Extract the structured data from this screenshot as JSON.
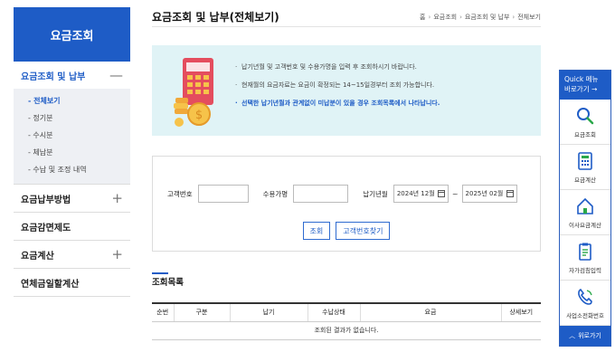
{
  "sidebar": {
    "header": "요금조회",
    "sections": [
      {
        "label": "요금조회 및 납부",
        "toggle": "—",
        "items": [
          "- 전체보기",
          "- 정기분",
          "- 수시분",
          "- 체납분",
          "- 수납 및 조정 내역"
        ]
      },
      {
        "label": "요금납부방법",
        "toggle": "+"
      },
      {
        "label": "요금감면제도",
        "toggle": ""
      },
      {
        "label": "요금계산",
        "toggle": "+"
      },
      {
        "label": "연체금일할계산",
        "toggle": ""
      }
    ]
  },
  "page": {
    "title": "요금조회 및 납부(전체보기)",
    "breadcrumb": [
      "홈",
      "요금조회",
      "요금조회 및 납부",
      "전체보기"
    ]
  },
  "info": {
    "lines": [
      "납기년월 및 고객번호 및 수용가명을 입력 후 조회하시기 바랍니다.",
      "현재월의 요금자료는 요금이 확정되는 14~15일경부터 조회 가능합니다.",
      "선택한 납기년월과 관계없이 미납분이 있을 경우 조회목록에서 나타납니다."
    ]
  },
  "search": {
    "customer_no_label": "고객번호",
    "customer_no_value": "",
    "name_label": "수용가명",
    "name_value": "",
    "period_label": "납기년월",
    "from": "2024년 12월",
    "tilde": "~",
    "to": "2025년 02월",
    "search_btn": "조회",
    "find_btn": "고객번호찾기"
  },
  "results": {
    "title": "조회목록",
    "columns": [
      "순번",
      "구분",
      "납기",
      "수납상태",
      "요금",
      "상세보기"
    ],
    "empty_message": "조회된 결과가 없습니다."
  },
  "quick": {
    "title_line1": "Quick 메뉴",
    "title_line2": "바로가기 →",
    "items": [
      "요금조회",
      "요금계산",
      "이사요금계산",
      "자가검침입력",
      "사업소전화번호"
    ],
    "top_label": "위로가기"
  },
  "colors": {
    "accent": "#1e5cc6",
    "info_bg": "#e0f3f6"
  }
}
